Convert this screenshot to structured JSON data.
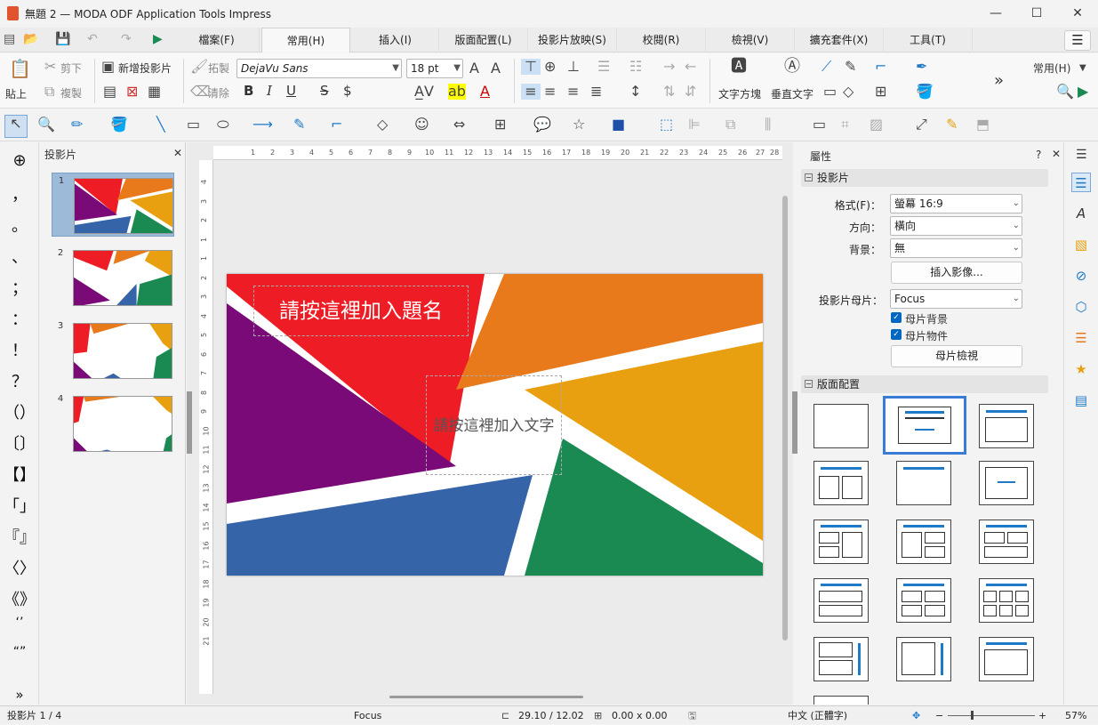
{
  "window": {
    "title": "無題 2 — MODA ODF Application Tools Impress",
    "minimize": "—",
    "maximize": "☐",
    "close": "✕"
  },
  "menu": {
    "tabs": [
      "檔案(F)",
      "常用(H)",
      "插入(I)",
      "版面配置(L)",
      "投影片放映(S)",
      "校閱(R)",
      "檢視(V)",
      "擴充套件(X)",
      "工具(T)"
    ],
    "active": "常用(H)",
    "menu_icon": "☰"
  },
  "toolbar": {
    "paste": "貼上",
    "cut": "剪下",
    "copy": "複製",
    "new_slide": "新增投影片",
    "clone": "拓製",
    "clear": "清除",
    "font_name": "DejaVu Sans",
    "font_size": "18 pt",
    "bold": "B",
    "italic": "I",
    "underline": "U",
    "strike": "S",
    "shadow": "$",
    "text_box": "文字方塊",
    "vertical_text": "垂直文字",
    "overflow": "»",
    "mode_label": "常用(H)"
  },
  "slides_panel": {
    "title": "投影片",
    "close": "✕",
    "numbers": [
      "1",
      "2",
      "3",
      "4"
    ],
    "selected": 1
  },
  "symbols": [
    "⊕",
    "，",
    "。",
    "、",
    "；",
    "：",
    "！",
    "？",
    "（）",
    "〔〕",
    "【】",
    "「」",
    "『』",
    "〈〉",
    "《》",
    "‘’",
    "“”",
    "»"
  ],
  "slide": {
    "title_placeholder": "請按這裡加入題名",
    "text_placeholder": "請按這裡加入文字"
  },
  "ruler": {
    "h_ticks": [
      "1",
      "2",
      "3",
      "4",
      "5",
      "6",
      "7",
      "8",
      "9",
      "10",
      "11",
      "12",
      "13",
      "14",
      "15",
      "16",
      "17",
      "18",
      "19",
      "20",
      "21",
      "22",
      "23",
      "24",
      "25",
      "26",
      "27",
      "28"
    ],
    "v_ticks": [
      "4",
      "3",
      "2",
      "1",
      "1",
      "2",
      "3",
      "4",
      "5",
      "6",
      "7",
      "8",
      "9",
      "10",
      "11",
      "12",
      "13",
      "14",
      "15",
      "16",
      "17",
      "18",
      "19",
      "20",
      "21"
    ]
  },
  "properties": {
    "title": "屬性",
    "help": "?",
    "close": "✕",
    "menu": "☰",
    "slide_section": "投影片",
    "format_label": "格式(F)：",
    "format_value": "螢幕 16:9",
    "orientation_label": "方向：",
    "orientation_value": "橫向",
    "background_label": "背景：",
    "background_value": "無",
    "insert_image": "插入影像...",
    "master_label": "投影片母片：",
    "master_value": "Focus",
    "master_background": "母片背景",
    "master_objects": "母片物件",
    "master_view": "母片檢視",
    "layout_section": "版面配置"
  },
  "status": {
    "slide": "投影片 1 / 4",
    "master": "Focus",
    "position": "29.10 / 12.02",
    "size": "0.00 x 0.00",
    "language": "中文 (正體字)",
    "zoom": "57%"
  },
  "colors": {
    "red": "#ee1c24",
    "orange": "#e87a1c",
    "yellow": "#e8a010",
    "green": "#1a8a52",
    "blue": "#3564a8",
    "purple": "#7a0a78",
    "accent": "#1e7ac8"
  }
}
